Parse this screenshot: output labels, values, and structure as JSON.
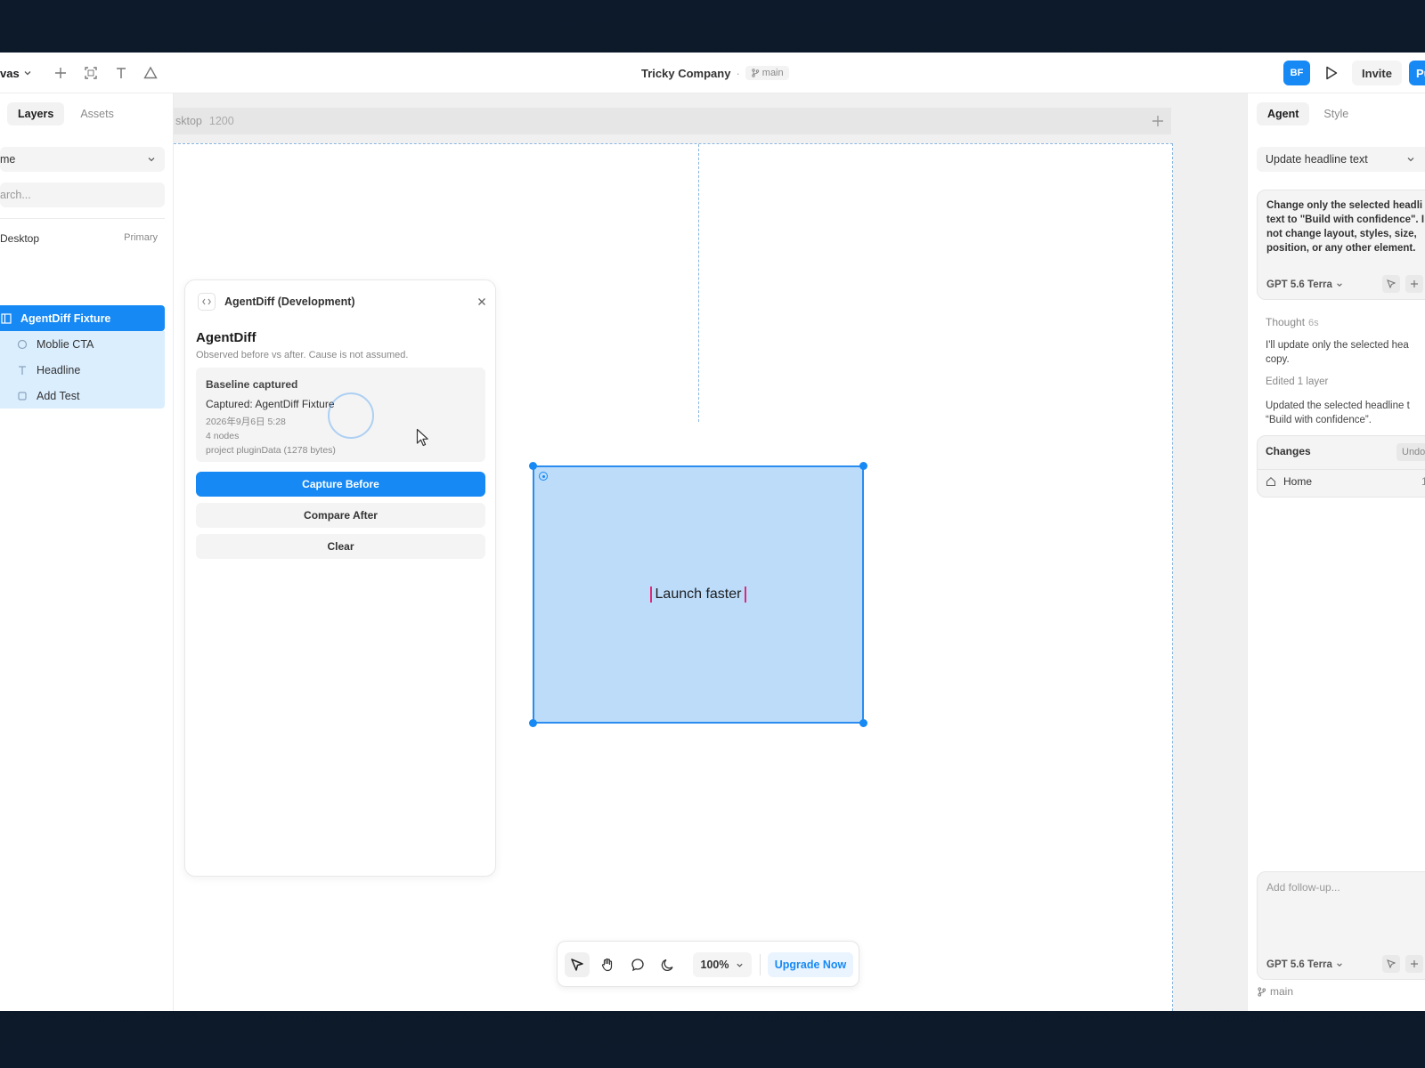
{
  "topbar": {
    "menu_label": "vas",
    "document_title": "Tricky Company",
    "title_separator": "·",
    "branch": "main",
    "avatar_initials": "BF",
    "invite_label": "Invite",
    "publish_label": "Pu"
  },
  "left": {
    "tabs": [
      {
        "label": "Layers"
      },
      {
        "label": "Assets"
      }
    ],
    "page_select": "me",
    "search_placeholder": "arch...",
    "frame_name": "Desktop",
    "frame_badge": "Primary",
    "layers": [
      {
        "label": "AgentDiff Fixture",
        "icon": "frame-icon"
      },
      {
        "label": "Moblie CTA",
        "icon": "circle-icon"
      },
      {
        "label": "Headline",
        "icon": "text-icon"
      },
      {
        "label": "Add Test",
        "icon": "square-icon"
      }
    ]
  },
  "canvas": {
    "frame_label": "sktop",
    "frame_size": "1200",
    "headline_text": "Launch faster"
  },
  "plugin": {
    "header": "AgentDiff (Development)",
    "title": "AgentDiff",
    "subtitle": "Observed before vs after. Cause is not assumed.",
    "status": "Baseline captured",
    "captured": "Captured: AgentDiff Fixture",
    "timestamp": "2026年9月6日 5:28",
    "nodes": "4 nodes",
    "plugin_data": "project pluginData (1278 bytes)",
    "buttons": {
      "capture_before": "Capture Before",
      "compare_after": "Compare After",
      "clear": "Clear"
    }
  },
  "toolbar": {
    "zoom": "100%",
    "upgrade": "Upgrade Now"
  },
  "right": {
    "tabs": [
      {
        "label": "Agent"
      },
      {
        "label": "Style"
      }
    ],
    "task_select": "Update headline text",
    "prompt": "Change only the selected headli text to \"Build with confidence\". I not change layout, styles, size, position, or any other element.",
    "model": "GPT 5.6 Terra",
    "thought_label": "Thought",
    "thought_secs": "6s",
    "thought_text": "I'll update only the selected hea copy.",
    "edited": "Edited 1 layer",
    "result": "Updated the selected headline t “Build with confidence”.",
    "changes_title": "Changes",
    "undo_label": "Undo",
    "change_item": "Home",
    "change_count": "1",
    "followup_placeholder": "Add follow-up...",
    "followup_model": "GPT 5.6 Terra",
    "branch": "main"
  },
  "colors": {
    "accent": "#1689f4",
    "selection_fill": "#bcdcfa",
    "caret": "#e0287a"
  }
}
